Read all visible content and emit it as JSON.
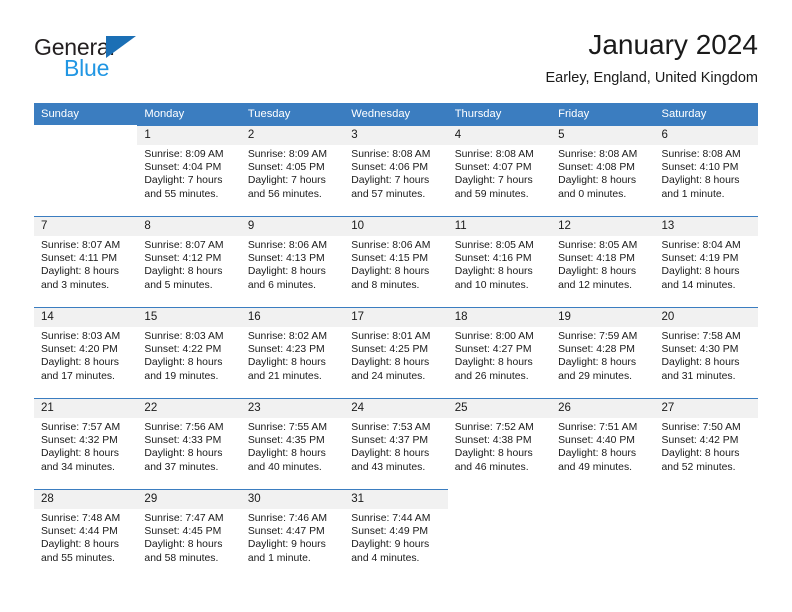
{
  "brand": {
    "name_part1": "General",
    "name_part2": "Blue",
    "triangle_icon": "triangle-icon",
    "color_dark": "#231f20",
    "color_blue": "#2196e3",
    "color_triangle": "#1b6fb5"
  },
  "header": {
    "title": "January 2024",
    "subtitle": "Earley, England, United Kingdom"
  },
  "theme": {
    "header_bg": "#3b7dc0",
    "daynum_bg": "#f1f1f1",
    "row_rule": "#3b7dc0"
  },
  "weekdays": [
    "Sunday",
    "Monday",
    "Tuesday",
    "Wednesday",
    "Thursday",
    "Friday",
    "Saturday"
  ],
  "weeks": [
    [
      {
        "day": "",
        "sunrise": "",
        "sunset": "",
        "daylight1": "",
        "daylight2": ""
      },
      {
        "day": "1",
        "sunrise": "Sunrise: 8:09 AM",
        "sunset": "Sunset: 4:04 PM",
        "daylight1": "Daylight: 7 hours",
        "daylight2": "and 55 minutes."
      },
      {
        "day": "2",
        "sunrise": "Sunrise: 8:09 AM",
        "sunset": "Sunset: 4:05 PM",
        "daylight1": "Daylight: 7 hours",
        "daylight2": "and 56 minutes."
      },
      {
        "day": "3",
        "sunrise": "Sunrise: 8:08 AM",
        "sunset": "Sunset: 4:06 PM",
        "daylight1": "Daylight: 7 hours",
        "daylight2": "and 57 minutes."
      },
      {
        "day": "4",
        "sunrise": "Sunrise: 8:08 AM",
        "sunset": "Sunset: 4:07 PM",
        "daylight1": "Daylight: 7 hours",
        "daylight2": "and 59 minutes."
      },
      {
        "day": "5",
        "sunrise": "Sunrise: 8:08 AM",
        "sunset": "Sunset: 4:08 PM",
        "daylight1": "Daylight: 8 hours",
        "daylight2": "and 0 minutes."
      },
      {
        "day": "6",
        "sunrise": "Sunrise: 8:08 AM",
        "sunset": "Sunset: 4:10 PM",
        "daylight1": "Daylight: 8 hours",
        "daylight2": "and 1 minute."
      }
    ],
    [
      {
        "day": "7",
        "sunrise": "Sunrise: 8:07 AM",
        "sunset": "Sunset: 4:11 PM",
        "daylight1": "Daylight: 8 hours",
        "daylight2": "and 3 minutes."
      },
      {
        "day": "8",
        "sunrise": "Sunrise: 8:07 AM",
        "sunset": "Sunset: 4:12 PM",
        "daylight1": "Daylight: 8 hours",
        "daylight2": "and 5 minutes."
      },
      {
        "day": "9",
        "sunrise": "Sunrise: 8:06 AM",
        "sunset": "Sunset: 4:13 PM",
        "daylight1": "Daylight: 8 hours",
        "daylight2": "and 6 minutes."
      },
      {
        "day": "10",
        "sunrise": "Sunrise: 8:06 AM",
        "sunset": "Sunset: 4:15 PM",
        "daylight1": "Daylight: 8 hours",
        "daylight2": "and 8 minutes."
      },
      {
        "day": "11",
        "sunrise": "Sunrise: 8:05 AM",
        "sunset": "Sunset: 4:16 PM",
        "daylight1": "Daylight: 8 hours",
        "daylight2": "and 10 minutes."
      },
      {
        "day": "12",
        "sunrise": "Sunrise: 8:05 AM",
        "sunset": "Sunset: 4:18 PM",
        "daylight1": "Daylight: 8 hours",
        "daylight2": "and 12 minutes."
      },
      {
        "day": "13",
        "sunrise": "Sunrise: 8:04 AM",
        "sunset": "Sunset: 4:19 PM",
        "daylight1": "Daylight: 8 hours",
        "daylight2": "and 14 minutes."
      }
    ],
    [
      {
        "day": "14",
        "sunrise": "Sunrise: 8:03 AM",
        "sunset": "Sunset: 4:20 PM",
        "daylight1": "Daylight: 8 hours",
        "daylight2": "and 17 minutes."
      },
      {
        "day": "15",
        "sunrise": "Sunrise: 8:03 AM",
        "sunset": "Sunset: 4:22 PM",
        "daylight1": "Daylight: 8 hours",
        "daylight2": "and 19 minutes."
      },
      {
        "day": "16",
        "sunrise": "Sunrise: 8:02 AM",
        "sunset": "Sunset: 4:23 PM",
        "daylight1": "Daylight: 8 hours",
        "daylight2": "and 21 minutes."
      },
      {
        "day": "17",
        "sunrise": "Sunrise: 8:01 AM",
        "sunset": "Sunset: 4:25 PM",
        "daylight1": "Daylight: 8 hours",
        "daylight2": "and 24 minutes."
      },
      {
        "day": "18",
        "sunrise": "Sunrise: 8:00 AM",
        "sunset": "Sunset: 4:27 PM",
        "daylight1": "Daylight: 8 hours",
        "daylight2": "and 26 minutes."
      },
      {
        "day": "19",
        "sunrise": "Sunrise: 7:59 AM",
        "sunset": "Sunset: 4:28 PM",
        "daylight1": "Daylight: 8 hours",
        "daylight2": "and 29 minutes."
      },
      {
        "day": "20",
        "sunrise": "Sunrise: 7:58 AM",
        "sunset": "Sunset: 4:30 PM",
        "daylight1": "Daylight: 8 hours",
        "daylight2": "and 31 minutes."
      }
    ],
    [
      {
        "day": "21",
        "sunrise": "Sunrise: 7:57 AM",
        "sunset": "Sunset: 4:32 PM",
        "daylight1": "Daylight: 8 hours",
        "daylight2": "and 34 minutes."
      },
      {
        "day": "22",
        "sunrise": "Sunrise: 7:56 AM",
        "sunset": "Sunset: 4:33 PM",
        "daylight1": "Daylight: 8 hours",
        "daylight2": "and 37 minutes."
      },
      {
        "day": "23",
        "sunrise": "Sunrise: 7:55 AM",
        "sunset": "Sunset: 4:35 PM",
        "daylight1": "Daylight: 8 hours",
        "daylight2": "and 40 minutes."
      },
      {
        "day": "24",
        "sunrise": "Sunrise: 7:53 AM",
        "sunset": "Sunset: 4:37 PM",
        "daylight1": "Daylight: 8 hours",
        "daylight2": "and 43 minutes."
      },
      {
        "day": "25",
        "sunrise": "Sunrise: 7:52 AM",
        "sunset": "Sunset: 4:38 PM",
        "daylight1": "Daylight: 8 hours",
        "daylight2": "and 46 minutes."
      },
      {
        "day": "26",
        "sunrise": "Sunrise: 7:51 AM",
        "sunset": "Sunset: 4:40 PM",
        "daylight1": "Daylight: 8 hours",
        "daylight2": "and 49 minutes."
      },
      {
        "day": "27",
        "sunrise": "Sunrise: 7:50 AM",
        "sunset": "Sunset: 4:42 PM",
        "daylight1": "Daylight: 8 hours",
        "daylight2": "and 52 minutes."
      }
    ],
    [
      {
        "day": "28",
        "sunrise": "Sunrise: 7:48 AM",
        "sunset": "Sunset: 4:44 PM",
        "daylight1": "Daylight: 8 hours",
        "daylight2": "and 55 minutes."
      },
      {
        "day": "29",
        "sunrise": "Sunrise: 7:47 AM",
        "sunset": "Sunset: 4:45 PM",
        "daylight1": "Daylight: 8 hours",
        "daylight2": "and 58 minutes."
      },
      {
        "day": "30",
        "sunrise": "Sunrise: 7:46 AM",
        "sunset": "Sunset: 4:47 PM",
        "daylight1": "Daylight: 9 hours",
        "daylight2": "and 1 minute."
      },
      {
        "day": "31",
        "sunrise": "Sunrise: 7:44 AM",
        "sunset": "Sunset: 4:49 PM",
        "daylight1": "Daylight: 9 hours",
        "daylight2": "and 4 minutes."
      },
      {
        "day": "",
        "sunrise": "",
        "sunset": "",
        "daylight1": "",
        "daylight2": ""
      },
      {
        "day": "",
        "sunrise": "",
        "sunset": "",
        "daylight1": "",
        "daylight2": ""
      },
      {
        "day": "",
        "sunrise": "",
        "sunset": "",
        "daylight1": "",
        "daylight2": ""
      }
    ]
  ]
}
